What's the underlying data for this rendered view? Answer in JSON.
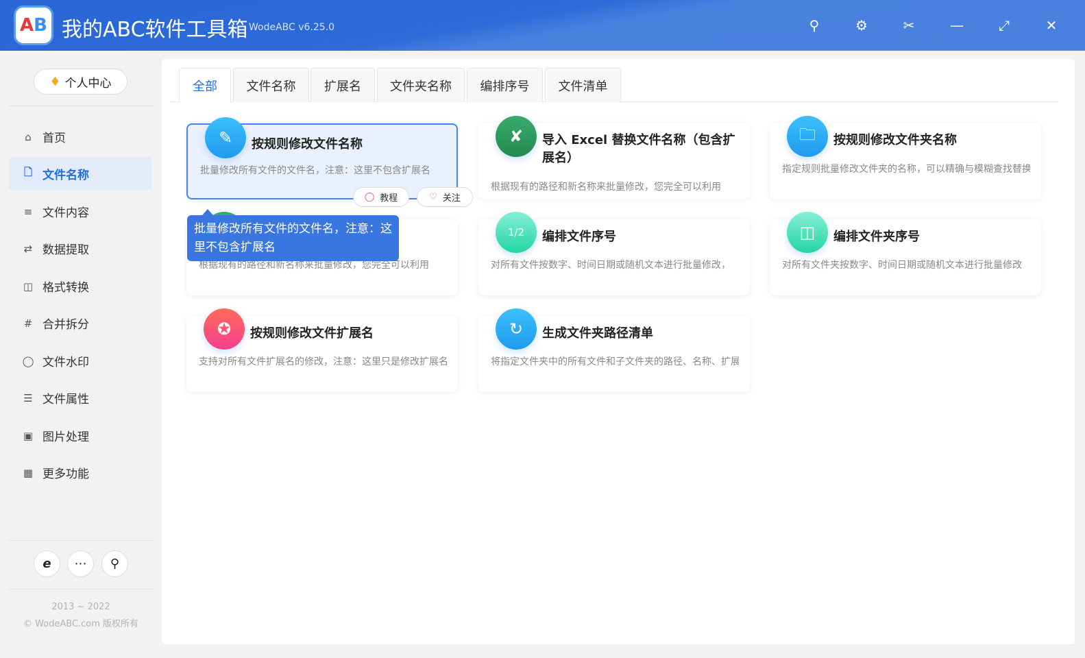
{
  "app": {
    "title": "我的ABC软件工具箱",
    "version": "WodeABC v6.25.0",
    "logo_text": "AB"
  },
  "titlebar_buttons": [
    "search-icon",
    "gear-icon",
    "scissors-icon",
    "minimize-icon",
    "maximize-icon",
    "close-icon"
  ],
  "sidebar": {
    "profile": "个人中心",
    "items": [
      {
        "label": "首页",
        "icon": "home-icon"
      },
      {
        "label": "文件名称",
        "icon": "file-icon",
        "active": true
      },
      {
        "label": "文件内容",
        "icon": "list-indent-icon"
      },
      {
        "label": "数据提取",
        "icon": "transfer-icon"
      },
      {
        "label": "格式转换",
        "icon": "convert-icon"
      },
      {
        "label": "合并拆分",
        "icon": "hash-icon"
      },
      {
        "label": "文件水印",
        "icon": "shield-icon"
      },
      {
        "label": "文件属性",
        "icon": "list-icon"
      },
      {
        "label": "图片处理",
        "icon": "image-icon"
      },
      {
        "label": "更多功能",
        "icon": "grid-icon"
      }
    ],
    "footer_years": "2013 ~ 2022",
    "footer_copy": "© WodeABC.com 版权所有"
  },
  "tabs": [
    "全部",
    "文件名称",
    "扩展名",
    "文件夹名称",
    "编排序号",
    "文件清单"
  ],
  "cards": [
    {
      "title": "按规则修改文件名称",
      "desc": "批量修改所有文件的文件名，注意：这里不包含扩展名",
      "color": "#2aa6f5"
    },
    {
      "title": "导入 Excel 替换文件名称（包含扩展名）",
      "desc": "根据现有的路径和新名称来批量修改，您完全可以利用",
      "color": "#2e9a5e"
    },
    {
      "title": "按规则修改文件夹名称",
      "desc": "指定规则批量修改文件夹的名称，可以精确与模糊查找替换",
      "color": "#2aa6f5"
    },
    {
      "title": "",
      "desc": "根据现有的路径和新名称来批量修改，您完全可以利用",
      "color": "#2e9a5e"
    },
    {
      "title": "编排文件序号",
      "desc": "对所有文件按数字、时间日期或随机文本进行批量修改，",
      "color": "#35d6a8"
    },
    {
      "title": "编排文件夹序号",
      "desc": "对所有文件夹按数字、时间日期或随机文本进行批量修改",
      "color": "#35d6a8"
    },
    {
      "title": "按规则修改文件扩展名",
      "desc": "支持对所有文件扩展名的修改，注意：这里只是修改扩展名",
      "color": "#f5507a"
    },
    {
      "title": "生成文件夹路径清单",
      "desc": "将指定文件夹中的所有文件和子文件夹的路径、名称、扩展名",
      "color": "#2aa6f5"
    }
  ],
  "card_actions": {
    "tutorial": "教程",
    "follow": "关注"
  },
  "tooltip": "批量修改所有文件的文件名，注意：这里不包含扩展名"
}
